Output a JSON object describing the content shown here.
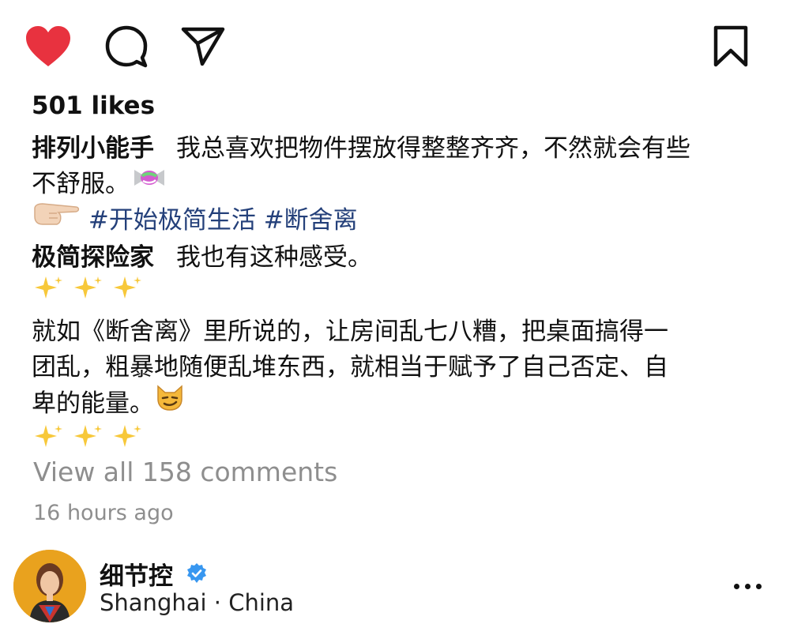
{
  "actions": {
    "like_icon": "heart-filled-icon",
    "comment_icon": "comment-bubble-icon",
    "share_icon": "paper-plane-icon",
    "save_icon": "bookmark-icon",
    "like_color": "#e8323f"
  },
  "likes": {
    "text": "501 likes"
  },
  "caption": {
    "username": "排列小能手",
    "text_line1": "我总喜欢把物件摆放得整整齐齐，不然就会有些",
    "text_line2": "不舒服。",
    "emoji_candy": "candy-emoji",
    "emoji_point": "pointing-right-hand-emoji",
    "hashtag1": "#开始极简生活",
    "hashtag2": "#断舍离"
  },
  "comment": {
    "username": "极简探险家",
    "text": "我也有这种感受。",
    "sparkles_emoji": "sparkles-emoji",
    "body_line1": "就如《断舍离》里所说的，让房间乱七八糟，把桌面搞得一",
    "body_line2": "团乱，粗暴地随便乱堆东西，就相当于赋予了自己否定、自",
    "body_line3": "卑的能量。",
    "emoji_cat": "smirking-cat-emoji"
  },
  "view_comments": "View all 158 comments",
  "timestamp": "16 hours ago",
  "author": {
    "name": "细节控",
    "verified": true,
    "location": "Shanghai · China",
    "verified_color": "#3897f0"
  },
  "more_icon": "more-horizontal-icon"
}
